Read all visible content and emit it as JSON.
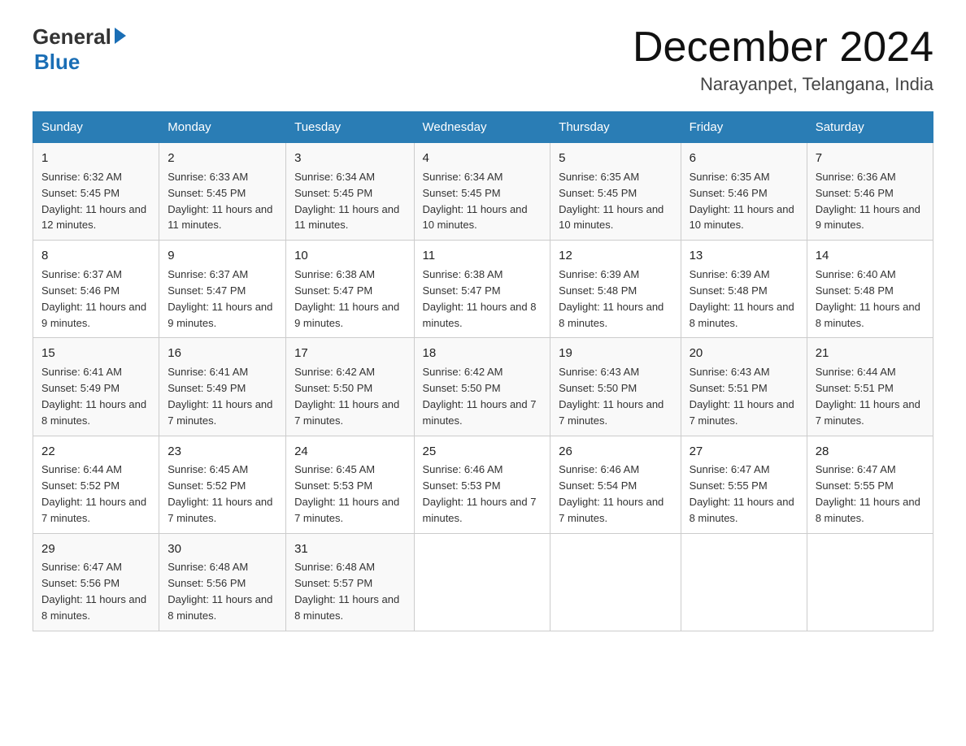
{
  "header": {
    "logo_general": "General",
    "logo_blue": "Blue",
    "main_title": "December 2024",
    "subtitle": "Narayanpet, Telangana, India"
  },
  "columns": [
    "Sunday",
    "Monday",
    "Tuesday",
    "Wednesday",
    "Thursday",
    "Friday",
    "Saturday"
  ],
  "weeks": [
    [
      {
        "day": "1",
        "sunrise": "6:32 AM",
        "sunset": "5:45 PM",
        "daylight": "11 hours and 12 minutes."
      },
      {
        "day": "2",
        "sunrise": "6:33 AM",
        "sunset": "5:45 PM",
        "daylight": "11 hours and 11 minutes."
      },
      {
        "day": "3",
        "sunrise": "6:34 AM",
        "sunset": "5:45 PM",
        "daylight": "11 hours and 11 minutes."
      },
      {
        "day": "4",
        "sunrise": "6:34 AM",
        "sunset": "5:45 PM",
        "daylight": "11 hours and 10 minutes."
      },
      {
        "day": "5",
        "sunrise": "6:35 AM",
        "sunset": "5:45 PM",
        "daylight": "11 hours and 10 minutes."
      },
      {
        "day": "6",
        "sunrise": "6:35 AM",
        "sunset": "5:46 PM",
        "daylight": "11 hours and 10 minutes."
      },
      {
        "day": "7",
        "sunrise": "6:36 AM",
        "sunset": "5:46 PM",
        "daylight": "11 hours and 9 minutes."
      }
    ],
    [
      {
        "day": "8",
        "sunrise": "6:37 AM",
        "sunset": "5:46 PM",
        "daylight": "11 hours and 9 minutes."
      },
      {
        "day": "9",
        "sunrise": "6:37 AM",
        "sunset": "5:47 PM",
        "daylight": "11 hours and 9 minutes."
      },
      {
        "day": "10",
        "sunrise": "6:38 AM",
        "sunset": "5:47 PM",
        "daylight": "11 hours and 9 minutes."
      },
      {
        "day": "11",
        "sunrise": "6:38 AM",
        "sunset": "5:47 PM",
        "daylight": "11 hours and 8 minutes."
      },
      {
        "day": "12",
        "sunrise": "6:39 AM",
        "sunset": "5:48 PM",
        "daylight": "11 hours and 8 minutes."
      },
      {
        "day": "13",
        "sunrise": "6:39 AM",
        "sunset": "5:48 PM",
        "daylight": "11 hours and 8 minutes."
      },
      {
        "day": "14",
        "sunrise": "6:40 AM",
        "sunset": "5:48 PM",
        "daylight": "11 hours and 8 minutes."
      }
    ],
    [
      {
        "day": "15",
        "sunrise": "6:41 AM",
        "sunset": "5:49 PM",
        "daylight": "11 hours and 8 minutes."
      },
      {
        "day": "16",
        "sunrise": "6:41 AM",
        "sunset": "5:49 PM",
        "daylight": "11 hours and 7 minutes."
      },
      {
        "day": "17",
        "sunrise": "6:42 AM",
        "sunset": "5:50 PM",
        "daylight": "11 hours and 7 minutes."
      },
      {
        "day": "18",
        "sunrise": "6:42 AM",
        "sunset": "5:50 PM",
        "daylight": "11 hours and 7 minutes."
      },
      {
        "day": "19",
        "sunrise": "6:43 AM",
        "sunset": "5:50 PM",
        "daylight": "11 hours and 7 minutes."
      },
      {
        "day": "20",
        "sunrise": "6:43 AM",
        "sunset": "5:51 PM",
        "daylight": "11 hours and 7 minutes."
      },
      {
        "day": "21",
        "sunrise": "6:44 AM",
        "sunset": "5:51 PM",
        "daylight": "11 hours and 7 minutes."
      }
    ],
    [
      {
        "day": "22",
        "sunrise": "6:44 AM",
        "sunset": "5:52 PM",
        "daylight": "11 hours and 7 minutes."
      },
      {
        "day": "23",
        "sunrise": "6:45 AM",
        "sunset": "5:52 PM",
        "daylight": "11 hours and 7 minutes."
      },
      {
        "day": "24",
        "sunrise": "6:45 AM",
        "sunset": "5:53 PM",
        "daylight": "11 hours and 7 minutes."
      },
      {
        "day": "25",
        "sunrise": "6:46 AM",
        "sunset": "5:53 PM",
        "daylight": "11 hours and 7 minutes."
      },
      {
        "day": "26",
        "sunrise": "6:46 AM",
        "sunset": "5:54 PM",
        "daylight": "11 hours and 7 minutes."
      },
      {
        "day": "27",
        "sunrise": "6:47 AM",
        "sunset": "5:55 PM",
        "daylight": "11 hours and 8 minutes."
      },
      {
        "day": "28",
        "sunrise": "6:47 AM",
        "sunset": "5:55 PM",
        "daylight": "11 hours and 8 minutes."
      }
    ],
    [
      {
        "day": "29",
        "sunrise": "6:47 AM",
        "sunset": "5:56 PM",
        "daylight": "11 hours and 8 minutes."
      },
      {
        "day": "30",
        "sunrise": "6:48 AM",
        "sunset": "5:56 PM",
        "daylight": "11 hours and 8 minutes."
      },
      {
        "day": "31",
        "sunrise": "6:48 AM",
        "sunset": "5:57 PM",
        "daylight": "11 hours and 8 minutes."
      },
      null,
      null,
      null,
      null
    ]
  ]
}
